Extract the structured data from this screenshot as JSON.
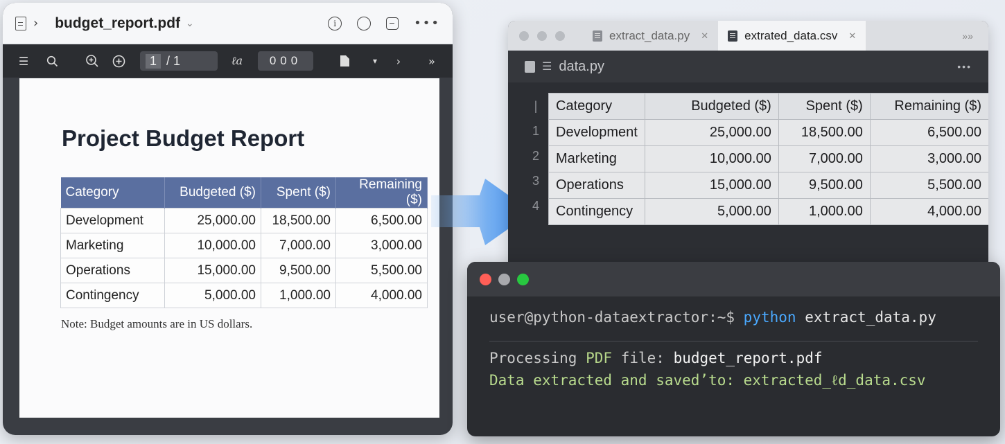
{
  "pdf_viewer": {
    "title": "budget_report.pdf",
    "page_current": "1",
    "page_total": "/ 1",
    "zoom": "000",
    "doc_title": "Project Budget Report",
    "table": {
      "headers": [
        "Category",
        "Budgeted ($)",
        "Spent ($)",
        "Remaining ($)"
      ],
      "rows": [
        [
          "Development",
          "25,000.00",
          "18,500.00",
          "6,500.00"
        ],
        [
          "Marketing",
          "10,000.00",
          "7,000.00",
          "3,000.00"
        ],
        [
          "Operations",
          "15,000.00",
          "9,500.00",
          "5,500.00"
        ],
        [
          "Contingency",
          "5,000.00",
          "1,000.00",
          "4,000.00"
        ]
      ]
    },
    "note": "Note: Budget amounts are in US dollars."
  },
  "editor": {
    "tabs": [
      {
        "label": "extract_data.py",
        "active": false
      },
      {
        "label": "extrated_data.csv",
        "active": true
      }
    ],
    "file_header": "data.py",
    "line_numbers": [
      "|",
      "1",
      "2",
      "3",
      "4"
    ],
    "table": {
      "headers": [
        "Category",
        "Budgeted ($)",
        "Spent ($)",
        "Remaining ($)"
      ],
      "rows": [
        [
          "Development",
          "25,000.00",
          "18,500.00",
          "6,500.00"
        ],
        [
          "Marketing",
          "10,000.00",
          "7,000.00",
          "3,000.00"
        ],
        [
          "Operations",
          "15,000.00",
          "9,500.00",
          "5,500.00"
        ],
        [
          "Contingency",
          "5,000.00",
          "1,000.00",
          "4,000.00"
        ]
      ]
    }
  },
  "terminal": {
    "prompt_user": "user@python-dataextractor:~$",
    "prompt_cmd": "python",
    "prompt_arg": "extract_data.py",
    "out1_prefix": "Processing",
    "out1_hl": "PDF",
    "out1_mid": "file:",
    "out1_file": "budget_report.pdf",
    "out2": "Data extracted and saved’to: extracted_ℓd_data.csv"
  },
  "colors": {
    "pdf_header_bg": "#5a6fa0",
    "term_red": "#ff5f57",
    "term_yellow": "#a8a9ad",
    "term_green": "#28c840",
    "term_cmd": "#4aa9ff",
    "term_output": "#b9dc8e",
    "arrow": "#4f9bf2"
  }
}
